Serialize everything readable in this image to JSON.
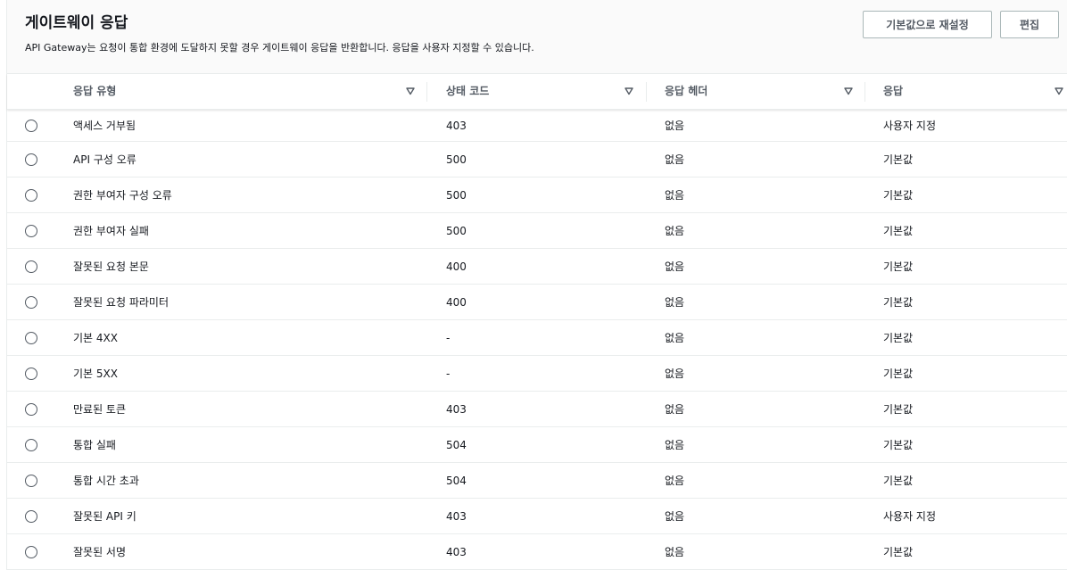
{
  "header": {
    "title": "게이트웨이 응답",
    "description": "API Gateway는 요청이 통합 환경에 도달하지 못할 경우 게이트웨이 응답을 반환합니다. 응답을 사용자 지정할 수 있습니다.",
    "reset_button": "기본값으로 재설정",
    "edit_button": "편집"
  },
  "table": {
    "columns": [
      "응답 유형",
      "상태 코드",
      "응답 헤더",
      "응답"
    ],
    "rows": [
      [
        "액세스 거부됨",
        "403",
        "없음",
        "사용자 지정"
      ],
      [
        "API 구성 오류",
        "500",
        "없음",
        "기본값"
      ],
      [
        "권한 부여자 구성 오류",
        "500",
        "없음",
        "기본값"
      ],
      [
        "권한 부여자 실패",
        "500",
        "없음",
        "기본값"
      ],
      [
        "잘못된 요청 본문",
        "400",
        "없음",
        "기본값"
      ],
      [
        "잘못된 요청 파라미터",
        "400",
        "없음",
        "기본값"
      ],
      [
        "기본 4XX",
        "-",
        "없음",
        "기본값"
      ],
      [
        "기본 5XX",
        "-",
        "없음",
        "기본값"
      ],
      [
        "만료된 토큰",
        "403",
        "없음",
        "기본값"
      ],
      [
        "통합 실패",
        "504",
        "없음",
        "기본값"
      ],
      [
        "통합 시간 초과",
        "504",
        "없음",
        "기본값"
      ],
      [
        "잘못된 API 키",
        "403",
        "없음",
        "사용자 지정"
      ],
      [
        "잘못된 서명",
        "403",
        "없음",
        "기본값"
      ]
    ]
  },
  "icons": {
    "sort": "caret-down-outline-icon",
    "row_select": "radio-button-icon"
  },
  "colors": {
    "text": "#16191f",
    "header_text": "#545b64",
    "border": "#eaeded",
    "header_background": "#fafafa",
    "button_border": "#aab7b8"
  }
}
